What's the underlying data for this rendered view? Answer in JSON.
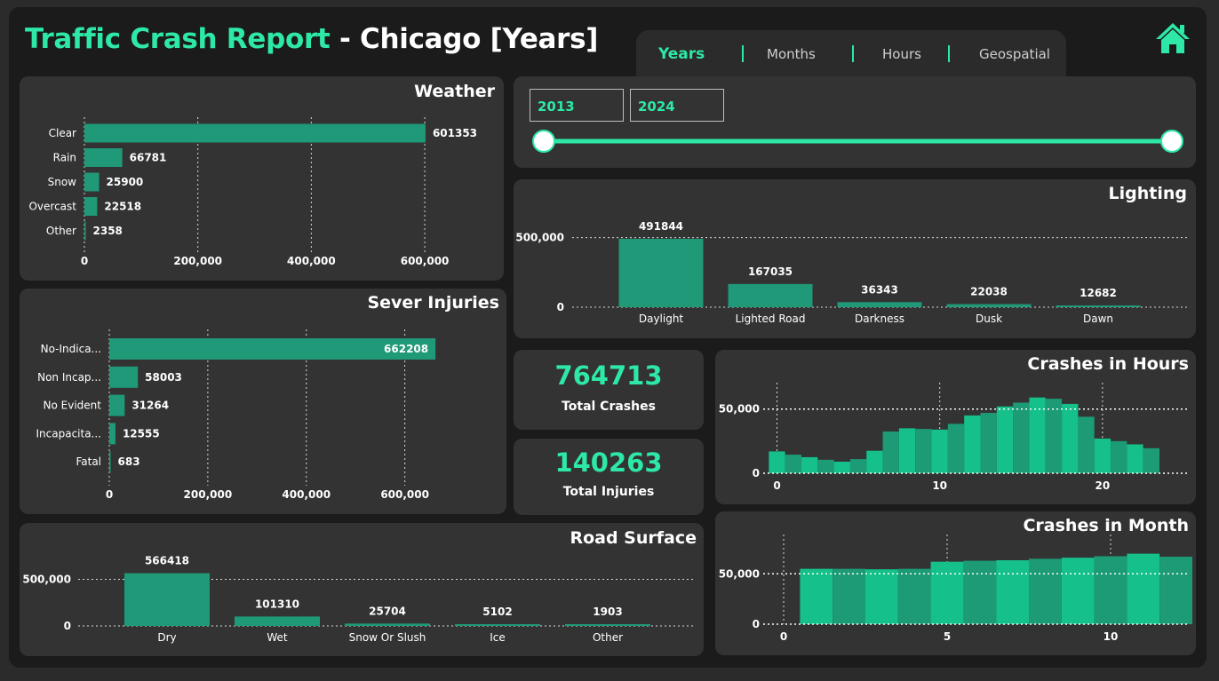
{
  "header": {
    "title_accent": "Traffic Crash Report",
    "title_rest": " - Chicago [Years]",
    "tabs": [
      "Years",
      "Months",
      "Hours",
      "Geospatial"
    ],
    "active_tab": "Years"
  },
  "colors": {
    "accent": "#2de8a6",
    "bar": "#1f9977",
    "panel": "#333333"
  },
  "year_range": {
    "start": "2013",
    "end": "2024"
  },
  "kpis": {
    "total_crashes": {
      "value": "764713",
      "label": "Total Crashes"
    },
    "total_injuries": {
      "value": "140263",
      "label": "Total Injuries"
    }
  },
  "chart_data": [
    {
      "id": "weather",
      "type": "bar",
      "orientation": "horizontal",
      "title": "Weather",
      "categories": [
        "Clear",
        "Rain",
        "Snow",
        "Overcast",
        "Other"
      ],
      "values": [
        601353,
        66781,
        25900,
        22518,
        2358
      ],
      "xlim": [
        0,
        650000
      ],
      "ticks": [
        0,
        200000,
        400000,
        600000
      ],
      "tick_labels": [
        "0",
        "200,000",
        "400,000",
        "600,000"
      ]
    },
    {
      "id": "severe",
      "type": "bar",
      "orientation": "horizontal",
      "title": "Sever Injuries",
      "categories": [
        "No-Indica...",
        "Non Incap...",
        "No Evident",
        "Incapacita...",
        "Fatal"
      ],
      "values": [
        662208,
        58003,
        31264,
        12555,
        683
      ],
      "xlim": [
        0,
        680000
      ],
      "ticks": [
        0,
        200000,
        400000,
        600000
      ],
      "tick_labels": [
        "0",
        "200,000",
        "400,000",
        "600,000"
      ]
    },
    {
      "id": "lighting",
      "type": "bar",
      "orientation": "vertical",
      "title": "Lighting",
      "categories": [
        "Daylight",
        "Lighted Road",
        "Darkness",
        "Dusk",
        "Dawn"
      ],
      "values": [
        491844,
        167035,
        36343,
        22038,
        12682
      ],
      "ylim": [
        0,
        600000
      ],
      "ticks": [
        0,
        500000
      ],
      "tick_labels": [
        "0",
        "500,000"
      ]
    },
    {
      "id": "road",
      "type": "bar",
      "orientation": "vertical",
      "title": "Road Surface",
      "categories": [
        "Dry",
        "Wet",
        "Snow Or Slush",
        "Ice",
        "Other"
      ],
      "values": [
        566418,
        101310,
        25704,
        5102,
        1903
      ],
      "ylim": [
        0,
        600000
      ],
      "ticks": [
        0,
        500000
      ],
      "tick_labels": [
        "0",
        "500,000"
      ]
    },
    {
      "id": "hours",
      "type": "area",
      "title": "Crashes in Hours",
      "x": [
        0,
        1,
        2,
        3,
        4,
        5,
        6,
        7,
        8,
        9,
        10,
        11,
        12,
        13,
        14,
        15,
        16,
        17,
        18,
        19,
        20,
        21,
        22,
        23
      ],
      "values": [
        17000,
        14500,
        12500,
        10500,
        9000,
        11000,
        17500,
        32500,
        35000,
        34500,
        34000,
        38500,
        45000,
        47000,
        52000,
        55000,
        59000,
        58000,
        54000,
        44000,
        27000,
        25000,
        22500,
        19500
      ],
      "xlim": [
        -0.3,
        23.5
      ],
      "ylim": [
        0,
        65000
      ],
      "xticks": [
        0,
        10,
        20
      ],
      "yticks": [
        0,
        50000
      ],
      "ytick_labels": [
        "0",
        "50,000"
      ]
    },
    {
      "id": "months",
      "type": "area",
      "title": "Crashes in Month",
      "x": [
        1,
        2,
        3,
        4,
        5,
        6,
        7,
        8,
        9,
        10,
        11,
        12
      ],
      "values": [
        55000,
        55000,
        54500,
        55000,
        62000,
        63000,
        63500,
        65000,
        66000,
        67500,
        70000,
        67000
      ],
      "xlim": [
        0,
        12.5
      ],
      "ylim": [
        0,
        82000
      ],
      "xticks": [
        0,
        5,
        10
      ],
      "yticks": [
        0,
        50000
      ],
      "ytick_labels": [
        "0",
        "50,000"
      ]
    }
  ]
}
